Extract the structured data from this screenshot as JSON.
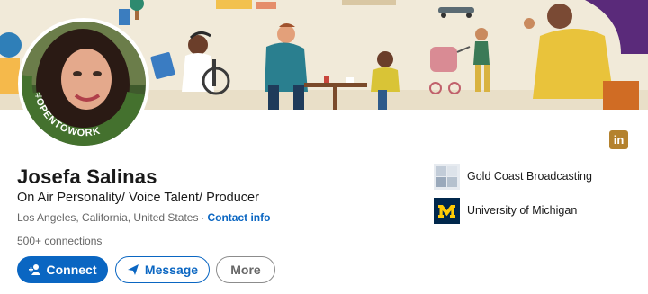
{
  "profile": {
    "name": "Josefa Salinas",
    "headline": "On Air Personality/ Voice Talent/ Producer",
    "location": "Los Angeles, California, United States",
    "separator": "·",
    "contact_info": "Contact info",
    "connections": "500+ connections",
    "open_to_work_badge": "#OPENTOWORK"
  },
  "actions": {
    "connect_label": "Connect",
    "message_label": "Message",
    "more_label": "More"
  },
  "experience": [
    {
      "name": "Gold Coast Broadcasting",
      "logo": "gold-coast-logo"
    },
    {
      "name": "University of Michigan",
      "logo": "michigan-block-m-logo"
    }
  ],
  "linkedin_badge": "in",
  "colors": {
    "linkedin_blue": "#0a66c2",
    "open_to_work_green": "#44712e",
    "banner_bg": "#f1ead9",
    "li_badge": "#b4822e",
    "michigan_blue": "#00274c",
    "michigan_maize": "#ffcb05"
  }
}
